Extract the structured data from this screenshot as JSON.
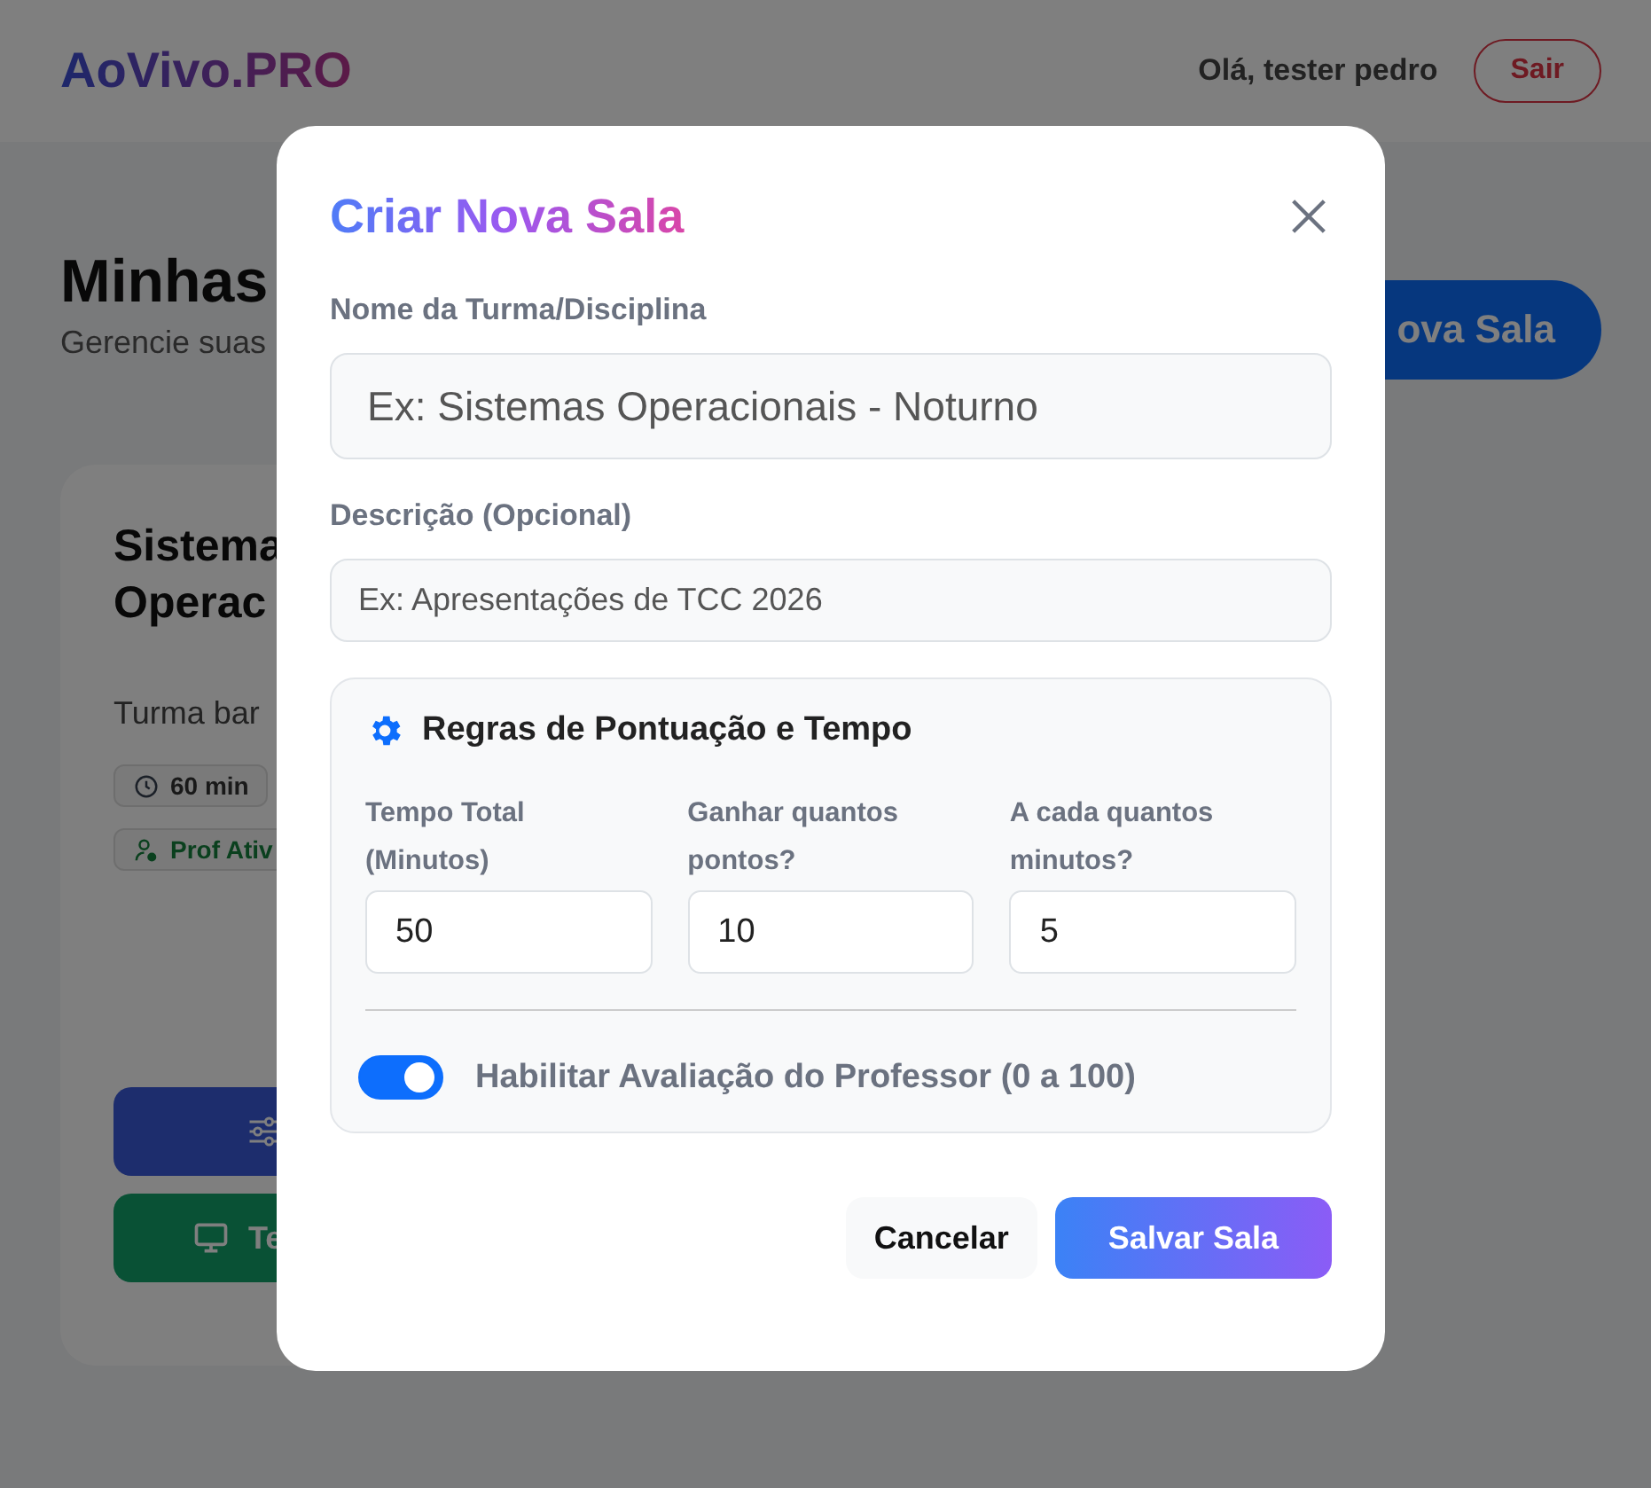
{
  "header": {
    "logo": "AoVivo.PRO",
    "greeting": "Olá, tester pedro",
    "logout_button": "Sair"
  },
  "page": {
    "title": "Minhas",
    "subtitle": "Gerencie suas",
    "new_room_button": "ova Sala"
  },
  "room_card": {
    "title_lines": [
      "Sistema",
      "Operac"
    ],
    "description": "Turma bar",
    "tags": [
      {
        "kind": "duration",
        "label": "60 min"
      },
      {
        "kind": "professor",
        "label": "Prof Ativ"
      }
    ],
    "buttons": [
      {
        "kind": "settings"
      },
      {
        "kind": "screen",
        "label": "Te"
      }
    ]
  },
  "modal": {
    "title": "Criar Nova Sala",
    "fields": [
      {
        "label": "Nome da Turma/Disciplina",
        "placeholder": "Ex: Sistemas Operacionais - Noturno",
        "kind": "large"
      },
      {
        "label": "Descrição (Opcional)",
        "placeholder": "Ex: Apresentações de TCC 2026",
        "kind": "small"
      }
    ],
    "rules": {
      "title": "Regras de Pontuação e Tempo",
      "fields": [
        {
          "label": "Tempo Total (Minutos)",
          "value": "50"
        },
        {
          "label": "Ganhar quantos pontos?",
          "value": "10"
        },
        {
          "label": "A cada quantos minutos?",
          "value": "5"
        }
      ],
      "toggle": {
        "label": "Habilitar Avaliação do Professor (0 a 100)",
        "on": true
      }
    },
    "buttons": [
      {
        "kind": "secondary",
        "label": "Cancelar"
      },
      {
        "kind": "primary",
        "label": "Salvar Sala"
      }
    ]
  }
}
